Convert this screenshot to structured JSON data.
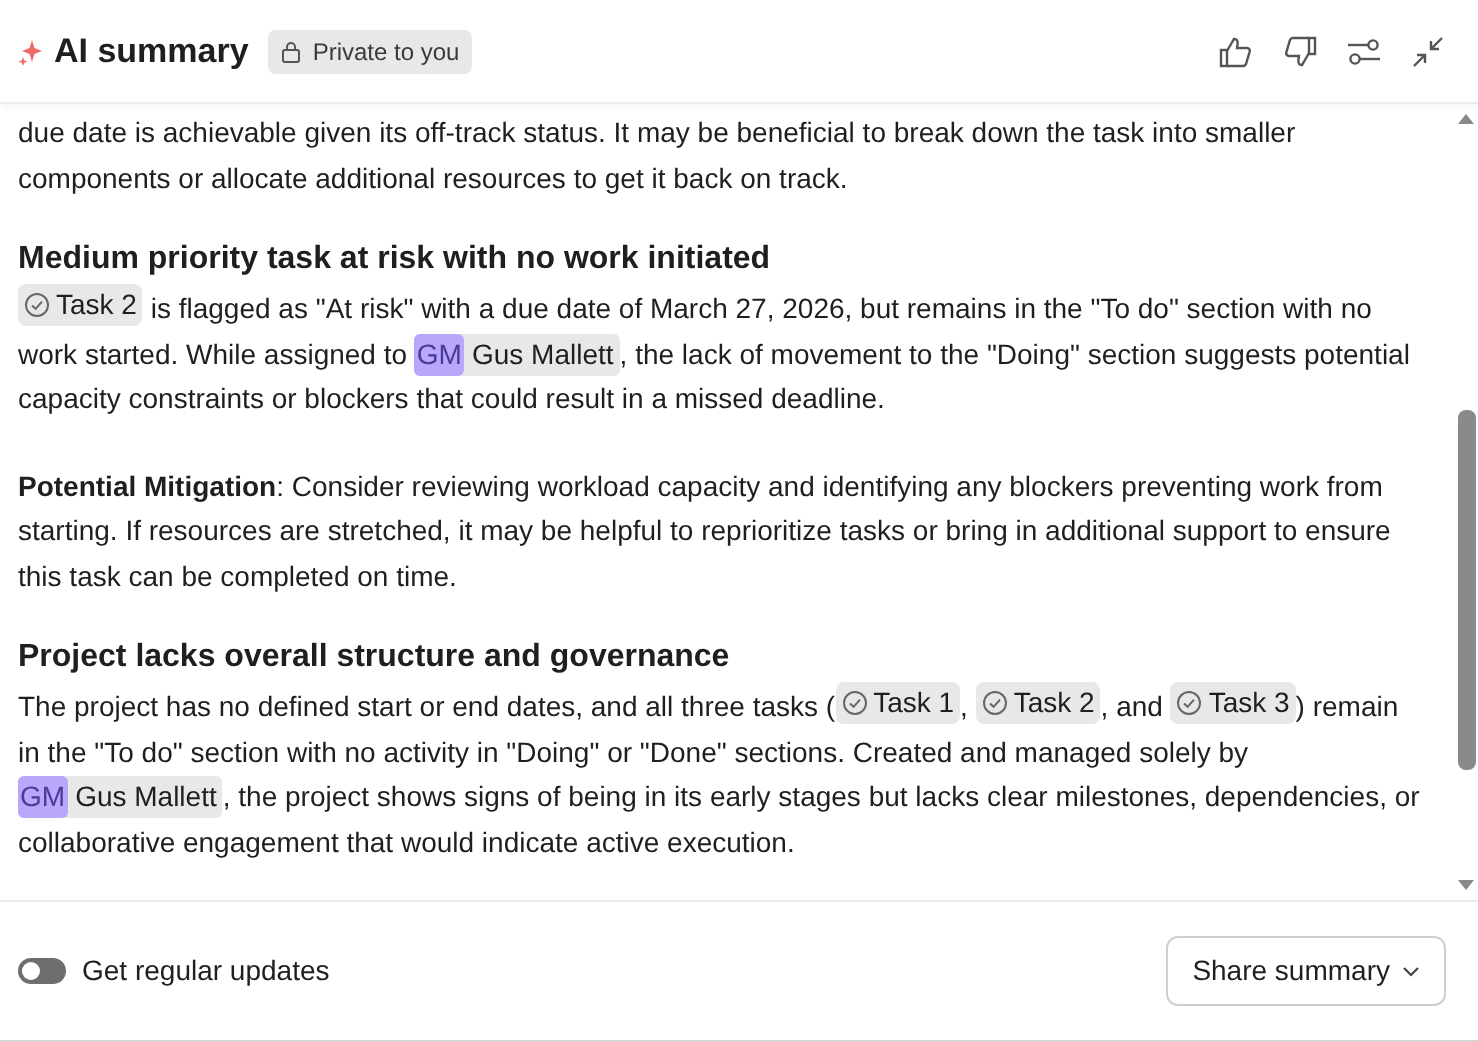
{
  "header": {
    "title": "AI summary",
    "badge": "Private to you"
  },
  "sections": [
    {
      "paragraphs": [
        [
          {
            "kind": "text",
            "text": "due date is achievable given its off-track status. It may be beneficial to break down the task into smaller components or allocate additional resources to get it back on track."
          }
        ]
      ]
    },
    {
      "heading": "Medium priority task at risk with no work initiated",
      "paragraphs": [
        [
          {
            "kind": "task",
            "text": "Task 2"
          },
          {
            "kind": "text",
            "text": " is flagged as \"At risk\" with a due date of March 27, 2026, but remains in the \"To do\" section with no work started. While assigned to "
          },
          {
            "kind": "mention",
            "initials": "GM",
            "text": "Gus Mallett"
          },
          {
            "kind": "text",
            "text": ", the lack of movement to the \"Doing\" section suggests potential capacity constraints or blockers that could result in a missed deadline."
          }
        ],
        [
          {
            "kind": "text",
            "text": "**Potential Mitigation**: Consider reviewing workload capacity and identifying any blockers preventing work from starting. If resources are stretched, it may be helpful to reprioritize tasks or bring in additional support to ensure this task can be completed on time."
          }
        ]
      ]
    },
    {
      "heading": "Project lacks overall structure and governance",
      "paragraphs": [
        [
          {
            "kind": "text",
            "text": "The project has no defined start or end dates, and all three tasks ("
          },
          {
            "kind": "task",
            "text": "Task 1"
          },
          {
            "kind": "text",
            "text": ", "
          },
          {
            "kind": "task",
            "text": "Task 2"
          },
          {
            "kind": "text",
            "text": ", and "
          },
          {
            "kind": "task",
            "text": "Task 3"
          },
          {
            "kind": "text",
            "text": ") remain in the \"To do\" section with no activity in \"Doing\" or \"Done\" sections. Created and managed solely by "
          },
          {
            "kind": "mention",
            "initials": "GM",
            "text": "Gus Mallett"
          },
          {
            "kind": "text",
            "text": ", the project shows signs of being in its early stages but lacks clear milestones, dependencies, or collaborative engagement that would indicate active execution."
          }
        ]
      ]
    }
  ],
  "footer": {
    "toggle": {
      "label": "Get regular updates",
      "on": false
    },
    "share_button": "Share summary"
  }
}
